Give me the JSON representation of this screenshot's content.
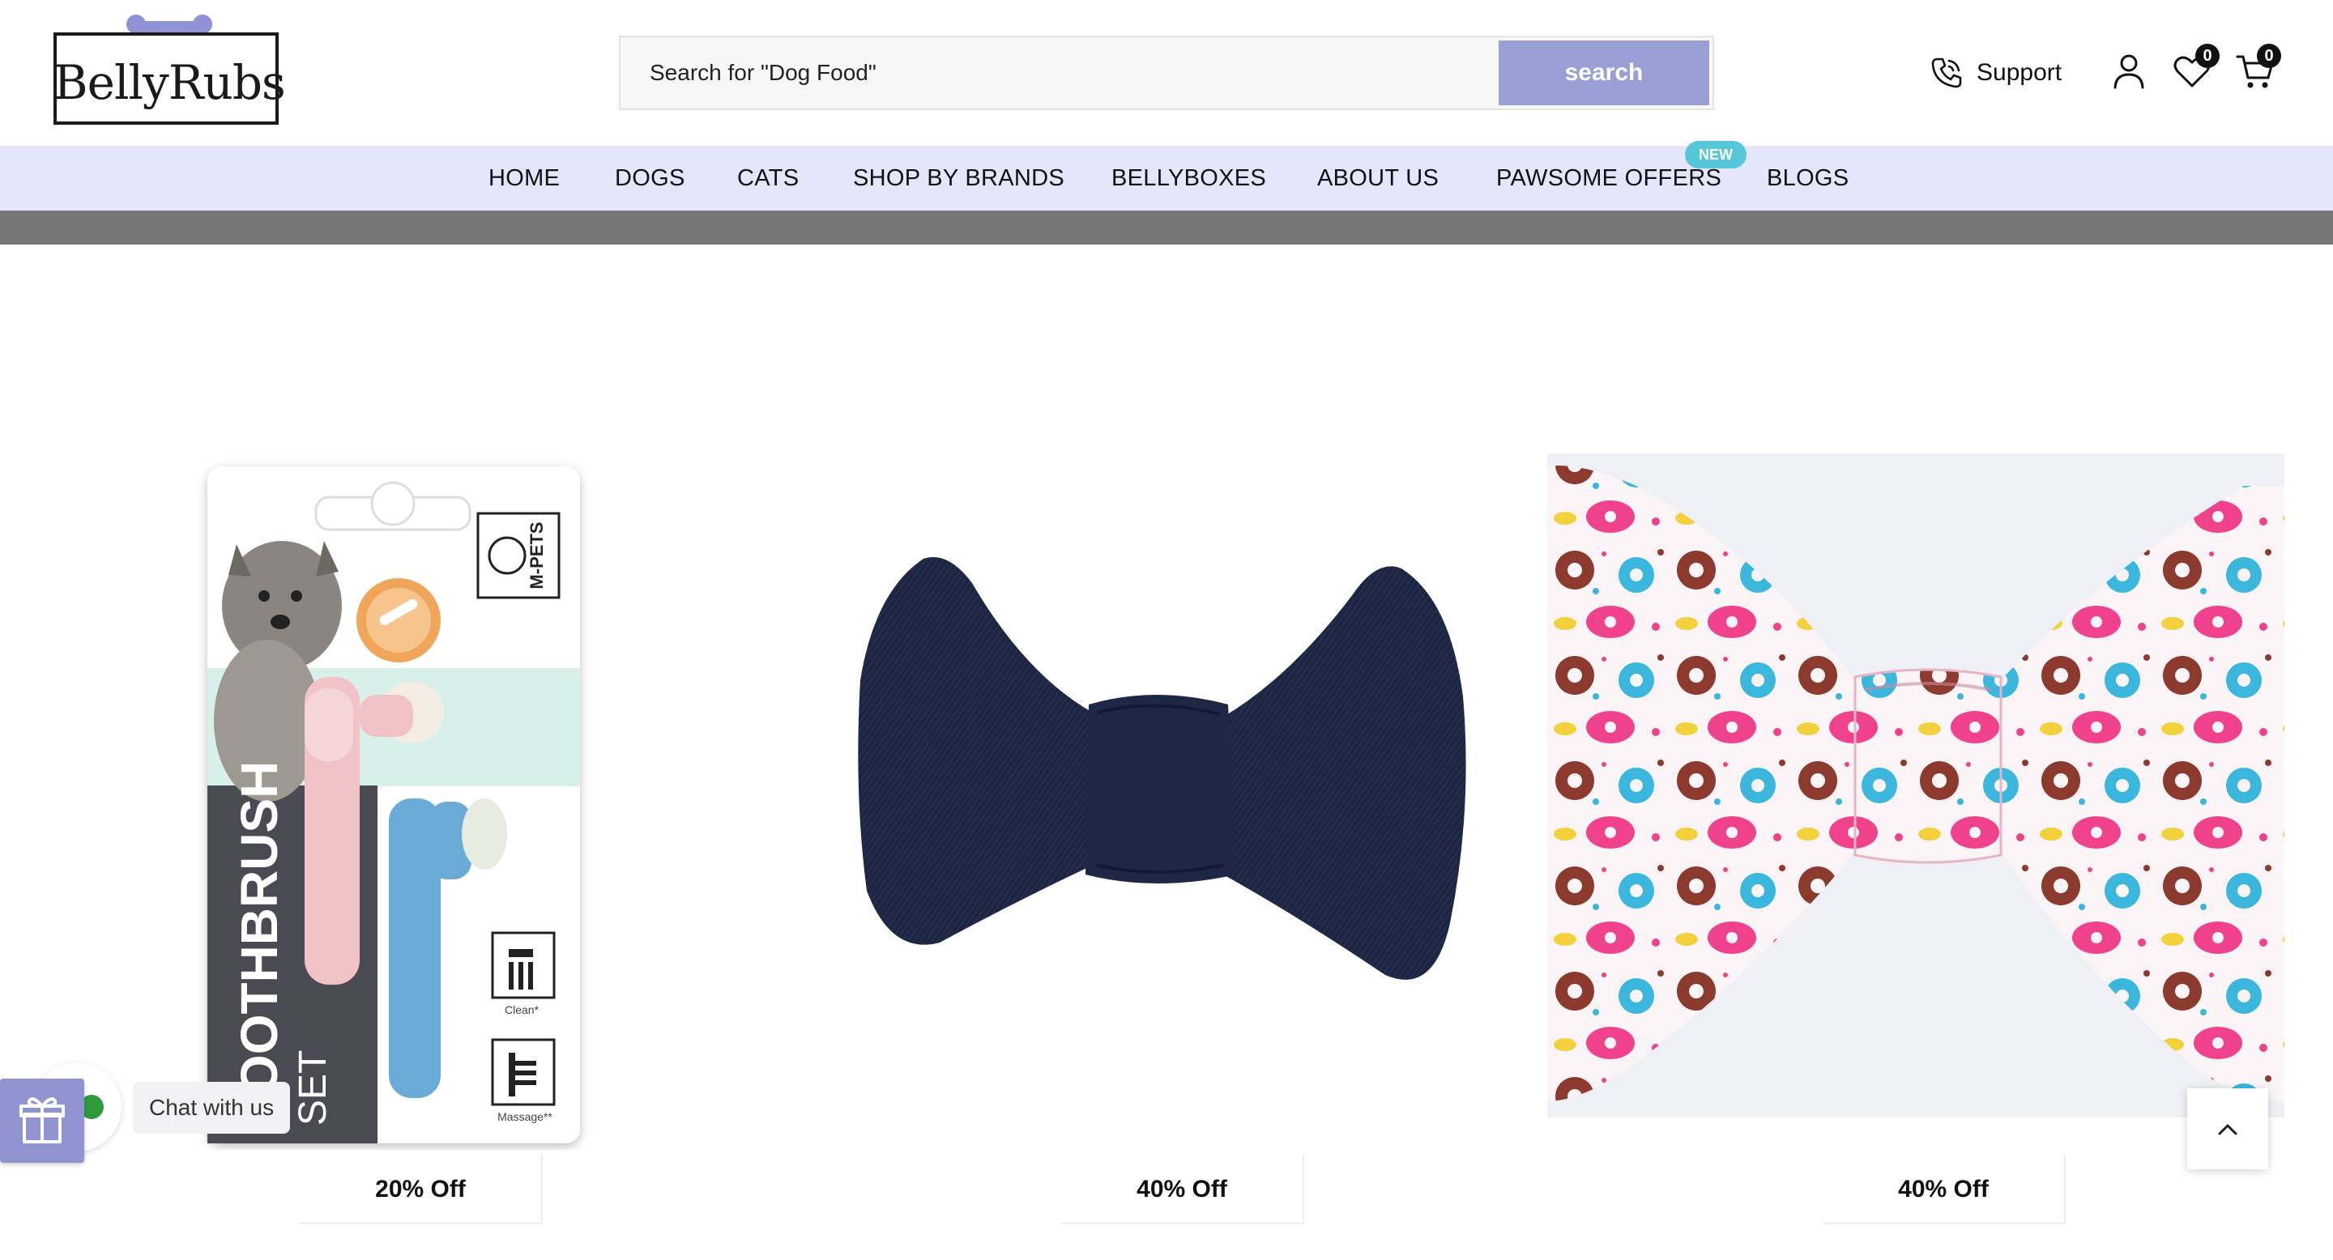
{
  "brand": {
    "name": "BellyRubs",
    "bone_color": "#8f93d6"
  },
  "search": {
    "placeholder": "Search for \"Dog Food\"",
    "button_label": "search"
  },
  "header_actions": {
    "support_label": "Support",
    "wishlist_count": "0",
    "cart_count": "0"
  },
  "nav": {
    "items": [
      {
        "label": "HOME"
      },
      {
        "label": "DOGS"
      },
      {
        "label": "CATS"
      },
      {
        "label": "SHOP BY BRANDS"
      },
      {
        "label": "BELLYBOXES"
      },
      {
        "label": "ABOUT US"
      },
      {
        "label": "PAWSOME OFFERS"
      },
      {
        "label": "BLOGS"
      }
    ],
    "new_badge": "NEW"
  },
  "products": [
    {
      "discount": "20% Off",
      "image": "finger-toothbrush-set",
      "image_text": {
        "brand": "M-PETS",
        "title": "TOOTHBRUSH",
        "subtitle": "SET",
        "clean": "Clean*",
        "massage": "Massage**"
      }
    },
    {
      "discount": "40% Off",
      "image": "denim-bow-tie"
    },
    {
      "discount": "40% Off",
      "image": "donut-print-bow-tie"
    }
  ],
  "chat": {
    "label": "Chat with us"
  },
  "colors": {
    "accent": "#9a9fd6",
    "nav_background": "#e4e6fb",
    "new_badge": "#56c6d8",
    "grey_strip": "#777777"
  }
}
